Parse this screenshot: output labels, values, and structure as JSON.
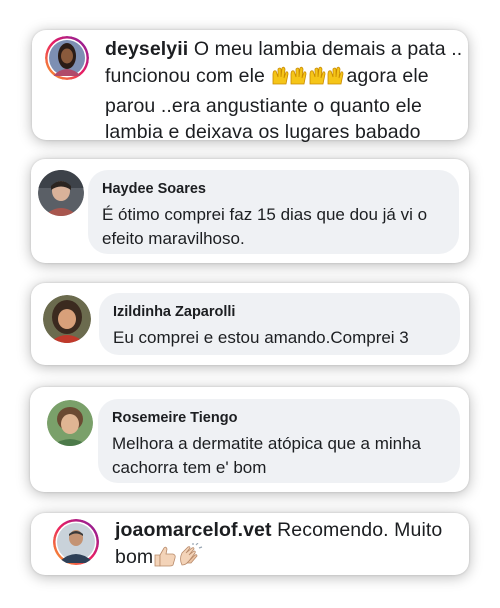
{
  "comments": [
    {
      "username": "deyselyii",
      "text_line1": " O meu lambia demais a pata ..",
      "text_line2a": "funcionou com ele ",
      "text_line2b": "agora ele",
      "text_line3": "parou ..era angustiante o quanto ele",
      "text_line4": "lambia e deixava os lugares babado",
      "emoji": "raising-hands-emoji",
      "emoji_count": 3
    },
    {
      "name": "Haydee Soares",
      "text_line1": "É ótimo comprei faz 15 dias que dou já vi o",
      "text_line2": "efeito maravilhoso."
    },
    {
      "name": "Izildinha Zaparolli",
      "text_line1": "Eu comprei e estou amando.Comprei 3"
    },
    {
      "name": "Rosemeire Tiengo",
      "text_line1": "Melhora a dermatite atópica que a minha",
      "text_line2": "cachorra tem e' bom"
    },
    {
      "username": "joaomarcelof.vet",
      "text_line1": " Recomendo. Muito",
      "text_line2": "bom",
      "emojis": [
        "thumbs-up-emoji",
        "clapping-hands-emoji"
      ]
    }
  ],
  "colors": {
    "card_bg": "#ffffff",
    "bubble_bg": "#eff1f4",
    "text": "#1c1e21",
    "emoji_yellow": "#f5c518"
  }
}
